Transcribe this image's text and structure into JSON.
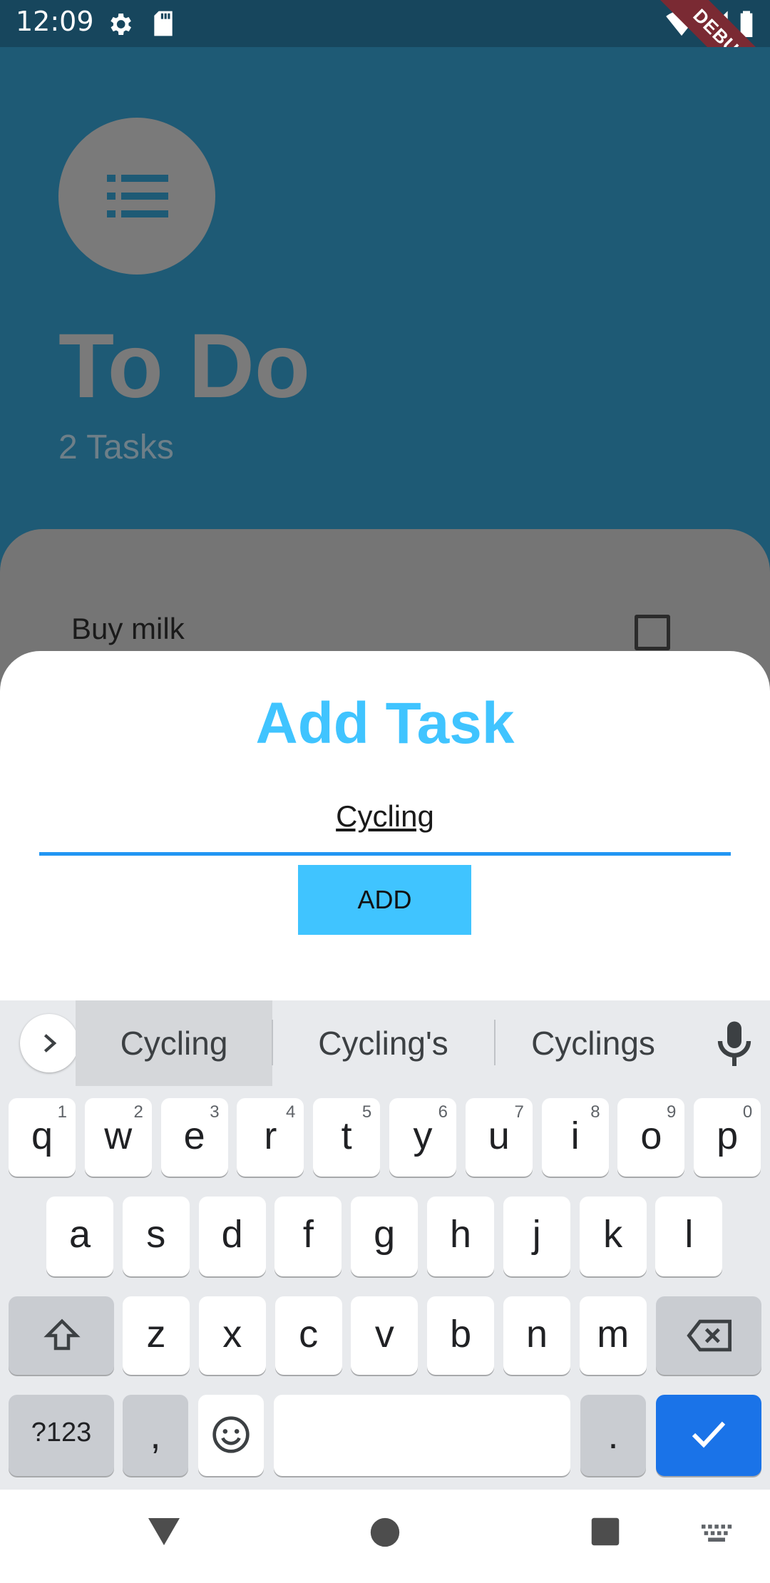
{
  "status_bar": {
    "time": "12:09",
    "debug_banner": "DEBUG"
  },
  "app": {
    "title": "To Do",
    "task_count": "2 Tasks",
    "tasks": [
      {
        "label": "Buy milk",
        "checked": false
      }
    ]
  },
  "add_task_sheet": {
    "title": "Add Task",
    "input_value": "Cycling",
    "add_button": "ADD"
  },
  "keyboard": {
    "suggestions": [
      "Cycling",
      "Cycling's",
      "Cyclings"
    ],
    "row1": [
      {
        "k": "q",
        "h": "1"
      },
      {
        "k": "w",
        "h": "2"
      },
      {
        "k": "e",
        "h": "3"
      },
      {
        "k": "r",
        "h": "4"
      },
      {
        "k": "t",
        "h": "5"
      },
      {
        "k": "y",
        "h": "6"
      },
      {
        "k": "u",
        "h": "7"
      },
      {
        "k": "i",
        "h": "8"
      },
      {
        "k": "o",
        "h": "9"
      },
      {
        "k": "p",
        "h": "0"
      }
    ],
    "row2": [
      "a",
      "s",
      "d",
      "f",
      "g",
      "h",
      "j",
      "k",
      "l"
    ],
    "row3": [
      "z",
      "x",
      "c",
      "v",
      "b",
      "n",
      "m"
    ],
    "symbols_key": "?123",
    "comma_key": ",",
    "period_key": "."
  },
  "colors": {
    "accent": "#40c4ff",
    "input_underline": "#2196f3",
    "enter_key": "#1a73e8",
    "app_bg": "#1e5a75"
  }
}
